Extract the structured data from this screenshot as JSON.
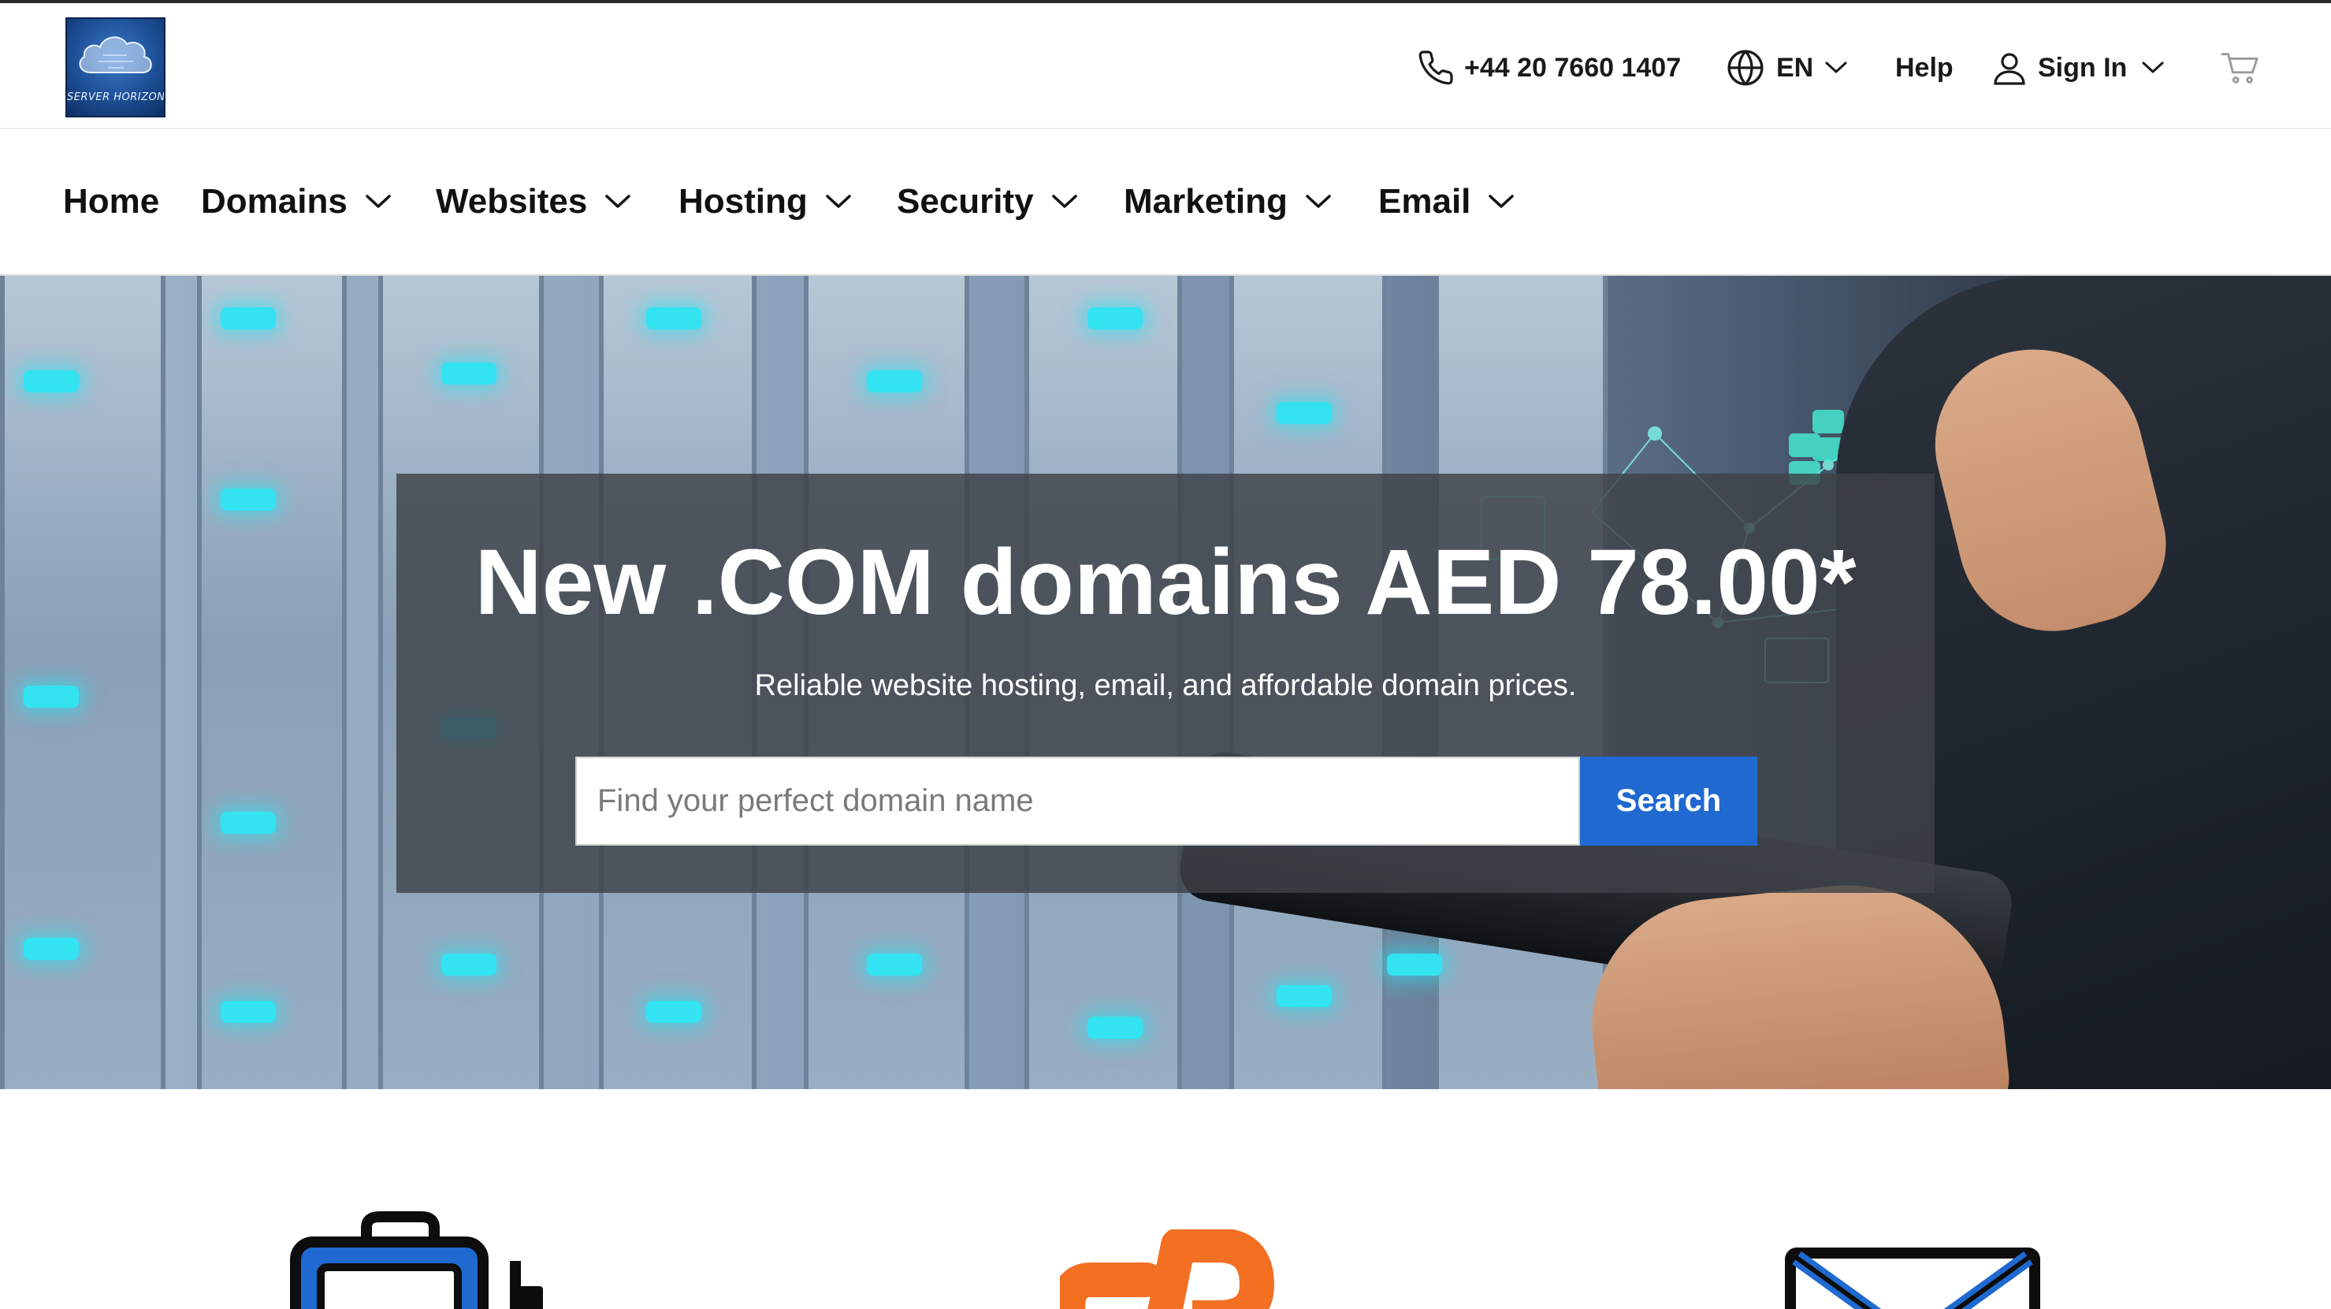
{
  "brand": {
    "logo_text": "SERVER HORIZON",
    "logo_icon": "cloud-icon"
  },
  "utility": {
    "phone": "+44 20 7660 1407",
    "phone_icon": "phone-icon",
    "language": "EN",
    "language_icon": "globe-icon",
    "help": "Help",
    "sign_in": "Sign In",
    "sign_in_icon": "user-icon",
    "cart_icon": "cart-icon"
  },
  "nav": {
    "items": [
      {
        "label": "Home",
        "has_dropdown": false
      },
      {
        "label": "Domains",
        "has_dropdown": true
      },
      {
        "label": "Websites",
        "has_dropdown": true
      },
      {
        "label": "Hosting",
        "has_dropdown": true
      },
      {
        "label": "Security",
        "has_dropdown": true
      },
      {
        "label": "Marketing",
        "has_dropdown": true
      },
      {
        "label": "Email",
        "has_dropdown": true
      }
    ]
  },
  "hero": {
    "title": "New .COM domains AED 78.00*",
    "subtitle": "Reliable website hosting, email, and affordable domain prices.",
    "search_placeholder": "Find your perfect domain name",
    "search_button": "Search"
  },
  "features": {
    "icons": [
      "briefcase-icon",
      "cpanel-icon",
      "envelope-icon"
    ]
  },
  "colors": {
    "accent_blue": "#1f69d1",
    "cpanel_orange": "#f36f21",
    "text_dark": "#111111",
    "hero_overlay": "#3e4248"
  }
}
